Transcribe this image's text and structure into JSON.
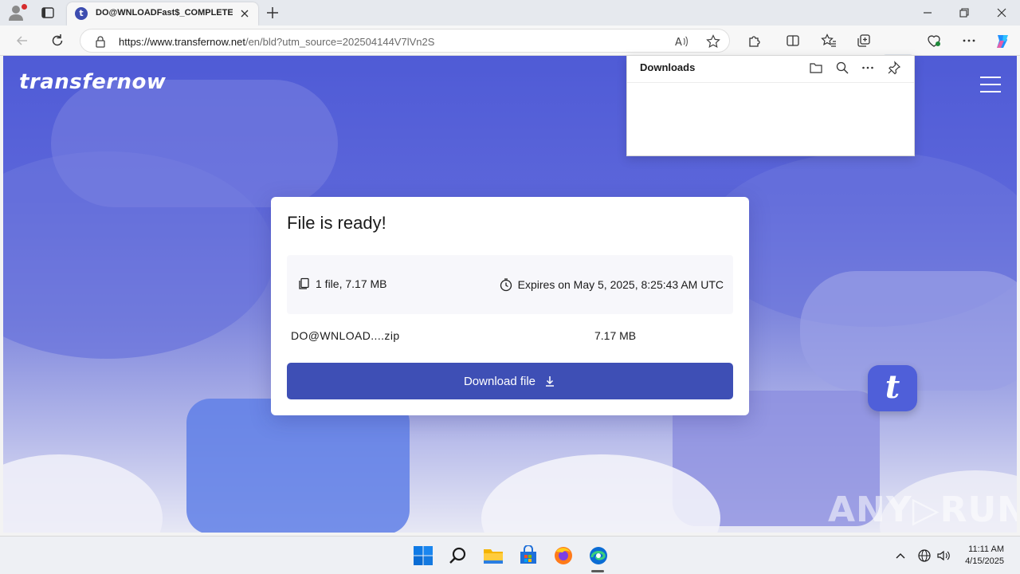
{
  "browser": {
    "tab_title": "DO@WNLOADFast$_COMPLETED",
    "favicon_letter": "t",
    "url_domain": "https://www.transfernow.net",
    "url_path": "/en/bld?utm_source=202504144V7lVn2S",
    "read_aloud_label": "Á"
  },
  "downloads_panel": {
    "title": "Downloads"
  },
  "site": {
    "logo": "transfernow",
    "badge_letter": "t",
    "watermark": "ANY▷RUN"
  },
  "card": {
    "title": "File is ready!",
    "file_summary": "1 file, 7.17 MB",
    "expires": "Expires on May 5, 2025, 8:25:43 AM UTC",
    "file_name": "DO@WNLOAD....zip",
    "file_size": "7.17 MB",
    "download_button": "Download file"
  },
  "taskbar": {
    "time": "11:11 AM",
    "date": "4/15/2025"
  },
  "colors": {
    "accent": "#3e4fb5",
    "hero_top": "#4f5bd6",
    "edge_blue": "#0a6cd4"
  },
  "icons": [
    "profile-icon",
    "tabs-icon",
    "close-icon",
    "plus-icon",
    "minimize-icon",
    "maximize-icon",
    "back-icon",
    "refresh-icon",
    "lock-icon",
    "read-aloud-icon",
    "favorite-star-icon",
    "extensions-icon",
    "split-screen-icon",
    "favorites-icon",
    "collections-icon",
    "download-icon",
    "browser-essentials-icon",
    "more-icon",
    "copilot-icon",
    "folder-icon",
    "search-icon",
    "pin-icon",
    "file-copy-icon",
    "clock-icon",
    "windows-start-icon",
    "file-explorer-icon",
    "store-icon",
    "firefox-icon",
    "edge-icon",
    "chevron-up-icon",
    "network-icon",
    "volume-icon",
    "menu-icon"
  ]
}
